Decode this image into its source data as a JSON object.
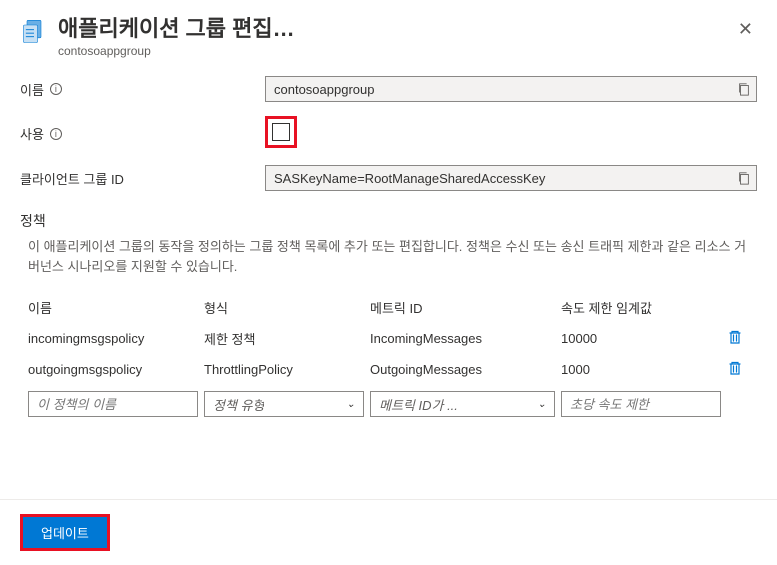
{
  "header": {
    "title": "애플리케이션 그룹 편집…",
    "subtitle": "contosoappgroup"
  },
  "fields": {
    "name_label": "이름",
    "name_value": "contosoappgroup",
    "enabled_label": "사용",
    "client_group_label": "클라이언트 그룹 ID",
    "client_group_value": "SASKeyName=RootManageSharedAccessKey"
  },
  "policies": {
    "section_title": "정책",
    "description": "이 애플리케이션 그룹의 동작을 정의하는 그룹 정책 목록에 추가 또는 편집합니다. 정책은 수신 또는 송신 트래픽 제한과 같은 리소스 거버넌스 시나리오를 지원할 수 있습니다.",
    "columns": {
      "name": "이름",
      "type": "형식",
      "metric": "메트릭 ID",
      "threshold": "속도 제한 임계값"
    },
    "rows": [
      {
        "name": "incomingmsgspolicy",
        "type": "제한 정책",
        "metric": "IncomingMessages",
        "threshold": "10000"
      },
      {
        "name": "outgoingmsgspolicy",
        "type": "ThrottlingPolicy",
        "metric": "OutgoingMessages",
        "threshold": "1000"
      }
    ],
    "inputs": {
      "name_placeholder": "이 정책의 이름",
      "type_placeholder": "정책 유형",
      "metric_placeholder": "메트릭 ID가 ...",
      "threshold_placeholder": "초당 속도 제한"
    }
  },
  "footer": {
    "update_label": "업데이트"
  }
}
